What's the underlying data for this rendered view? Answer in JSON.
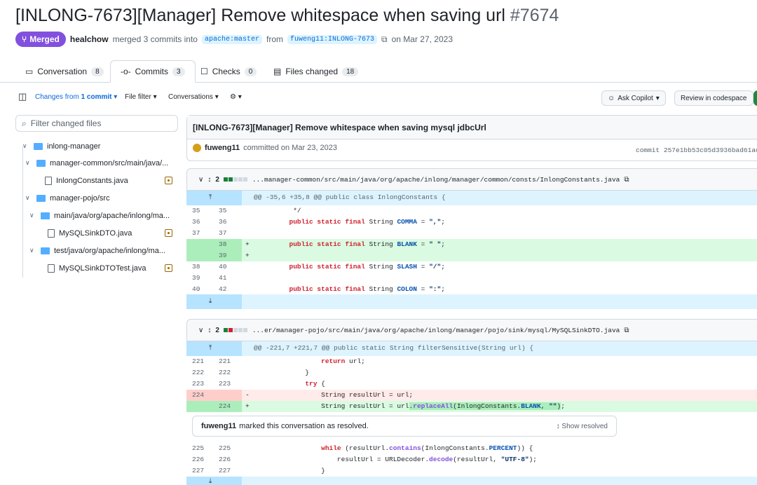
{
  "pr": {
    "title": "[INLONG-7673][Manager] Remove whitespace when saving url",
    "number": "#7674",
    "state": "Merged",
    "author": "healchow",
    "merge_text": "merged 3 commits into",
    "base": "apache:master",
    "from": "from",
    "head": "fuweng11:INLONG-7673",
    "date": "on Mar 27, 2023"
  },
  "tabs": [
    {
      "label": "Conversation",
      "count": "8",
      "icon": "comment-icon"
    },
    {
      "label": "Commits",
      "count": "3",
      "icon": "commit-icon"
    },
    {
      "label": "Checks",
      "count": "0",
      "icon": "checks-icon"
    },
    {
      "label": "Files changed",
      "count": "18",
      "icon": "file-diff-icon"
    }
  ],
  "toolbar": {
    "changes_prefix": "Changes from",
    "changes_value": "1 commit",
    "file_filter": "File filter",
    "conversations": "Conversations",
    "ask_copilot": "Ask Copilot",
    "review": "Review in codespace"
  },
  "sidebar": {
    "filter_placeholder": "Filter changed files",
    "tree": [
      "inlong-manager",
      "manager-common/src/main/java/...",
      "InlongConstants.java",
      "manager-pojo/src",
      "main/java/org/apache/inlong/ma...",
      "MySQLSinkDTO.java",
      "test/java/org/apache/inlong/ma...",
      "MySQLSinkDTOTest.java"
    ]
  },
  "commit": {
    "message": "[INLONG-7673][Manager] Remove whitespace when saving mysql jdbcUrl",
    "author": "fuweng11",
    "committed": "committed on Mar 23, 2023",
    "sha": "commit 257e1bb53c05d3936bad61ac"
  },
  "file1": {
    "count": "2",
    "path": "...manager-common/src/main/java/org/apache/inlong/manager/common/consts/InlongConstants.java",
    "hunk": "@@ -35,6 +35,8 @@ public class InlongConstants {"
  },
  "file2": {
    "count": "2",
    "path": "...er/manager-pojo/src/main/java/org/apache/inlong/manager/pojo/sink/mysql/MySQLSinkDTO.java",
    "hunk": "@@ -221,7 +221,7 @@ public static String filterSensitive(String url) {"
  },
  "resolved": {
    "user": "fuweng11",
    "text": "marked this conversation as resolved.",
    "button": "Show resolved"
  },
  "colors": {
    "merged": "#8250df",
    "add": "#dafbe1",
    "del": "#ffebe9",
    "hunk": "#ddf4ff"
  }
}
